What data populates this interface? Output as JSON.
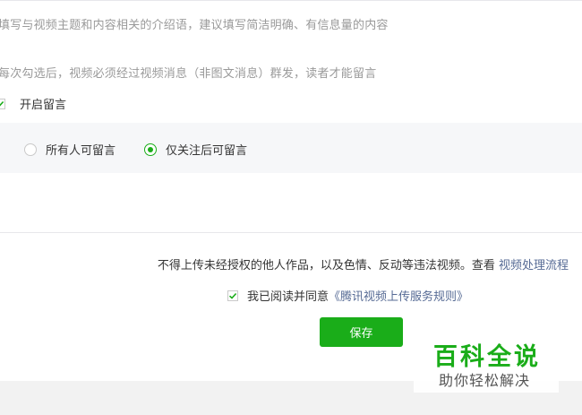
{
  "intro_hint": "填写与视频主题和内容相关的介绍语，建议填写简洁明确、有信息量的内容",
  "mass_send_hint": "每次勾选后，视频必须经过视频消息（非图文消息）群发，读者才能留言",
  "comment_toggle": {
    "label": "开启留言",
    "checked": true
  },
  "comment_scope": {
    "options": [
      {
        "label": "所有人可留言",
        "selected": false
      },
      {
        "label": "仅关注后可留言",
        "selected": true
      }
    ]
  },
  "notice": {
    "text": "不得上传未经授权的他人作品，以及色情、反动等违法视频。查看",
    "link": "视频处理流程"
  },
  "agreement": {
    "text": "我已阅读并同意",
    "link": "《腾讯视频上传服务规则》",
    "checked": true
  },
  "save_label": "保存",
  "watermark": {
    "title": "百科全说",
    "subtitle": "助你轻松解决"
  },
  "colors": {
    "accent": "#1aad19",
    "link": "#576b95",
    "hint": "#9a9a9a",
    "panel": "#f6f7f9"
  }
}
